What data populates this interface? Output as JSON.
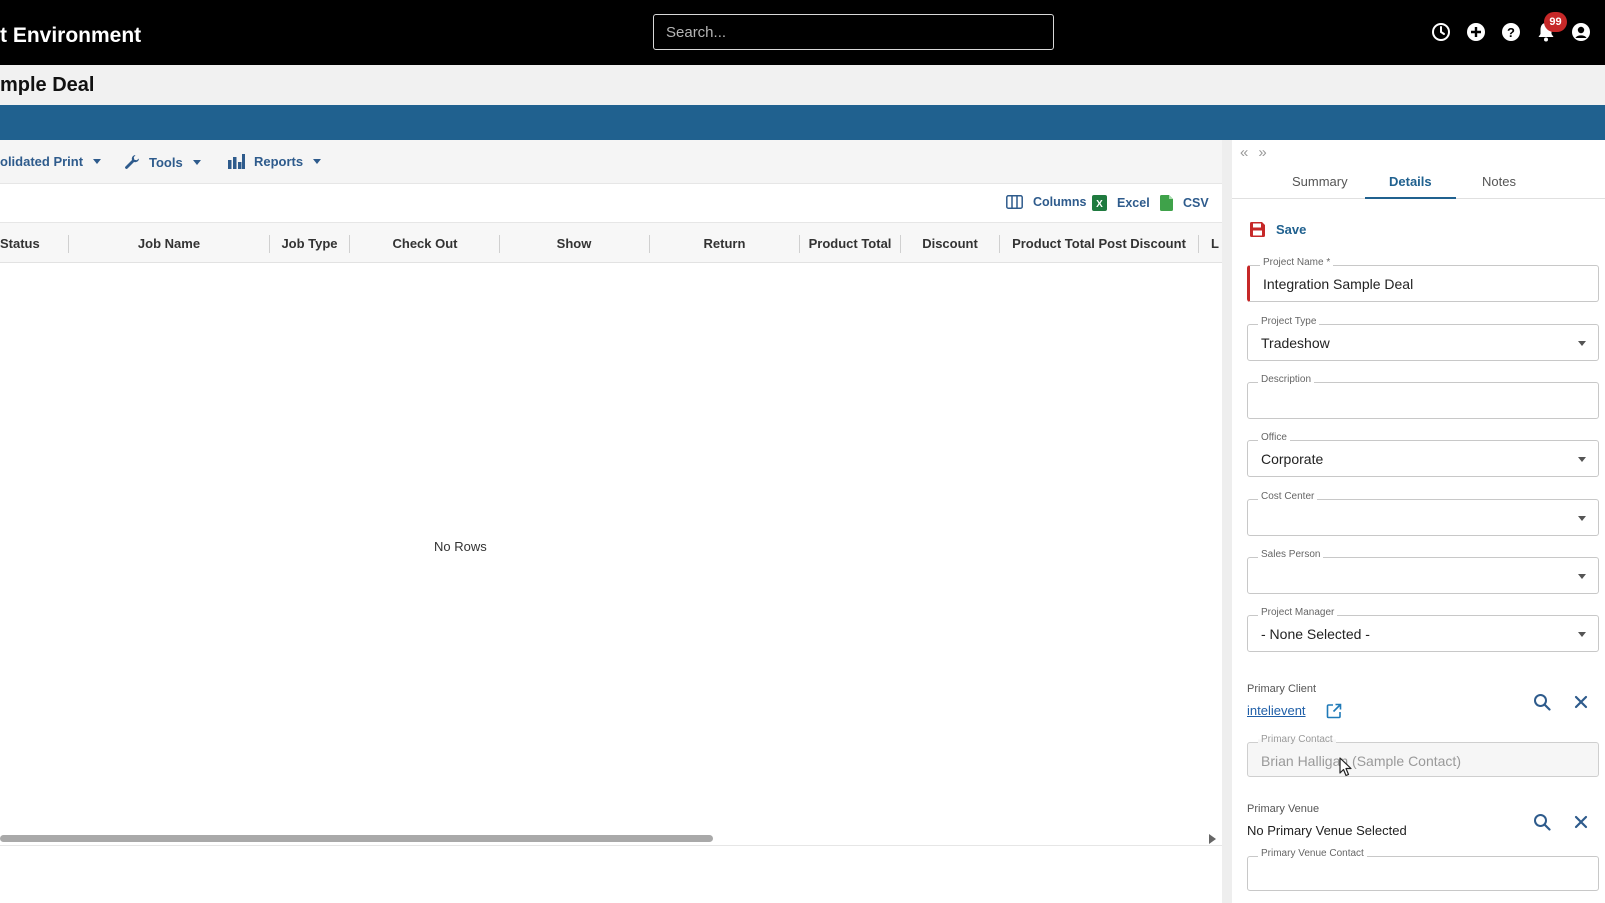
{
  "topbar": {
    "env_title": "t Environment",
    "search_placeholder": "Search...",
    "notification_count": "99"
  },
  "page": {
    "title": "mple Deal"
  },
  "toolbar": {
    "consolidated_print_label": "olidated Print",
    "tools_label": "Tools",
    "reports_label": "Reports"
  },
  "grid": {
    "export": {
      "columns_label": "Columns",
      "excel_label": "Excel",
      "csv_label": "CSV"
    },
    "columns": [
      "Status",
      "Job Name",
      "Job Type",
      "Check Out",
      "Show",
      "Return",
      "Product Total",
      "Discount",
      "Product Total Post Discount",
      "L"
    ],
    "empty_message": "No Rows"
  },
  "side_panel": {
    "tabs": [
      "Summary",
      "Details",
      "Notes"
    ],
    "active_tab": "Details",
    "save_label": "Save",
    "fields": {
      "project_name": {
        "label": "Project Name *",
        "value": "Integration Sample Deal"
      },
      "project_type": {
        "label": "Project Type",
        "value": "Tradeshow"
      },
      "description": {
        "label": "Description",
        "value": ""
      },
      "office": {
        "label": "Office",
        "value": "Corporate"
      },
      "cost_center": {
        "label": "Cost Center",
        "value": ""
      },
      "sales_person": {
        "label": "Sales Person",
        "value": ""
      },
      "project_manager": {
        "label": "Project Manager",
        "value": "- None Selected -"
      }
    },
    "primary_client": {
      "label": "Primary Client",
      "value": "intelievent",
      "contact_label": "Primary Contact",
      "contact_value": "Brian Halligan (Sample Contact)"
    },
    "primary_venue": {
      "label": "Primary Venue",
      "value": "No Primary Venue Selected",
      "contact_label": "Primary Venue Contact",
      "contact_value": ""
    }
  },
  "colors": {
    "topbar_bg": "#000000",
    "accent_blue": "#20618f",
    "link_blue": "#1f5fa8",
    "required_red": "#c62828"
  }
}
